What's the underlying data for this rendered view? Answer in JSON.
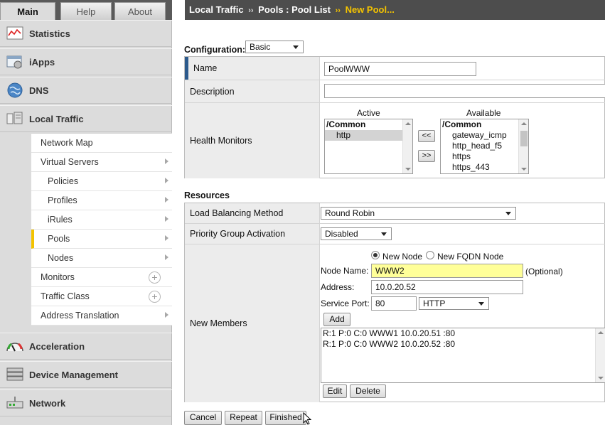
{
  "nav": {
    "tabs": [
      "Main",
      "Help",
      "About"
    ],
    "sections": {
      "statistics": "Statistics",
      "iapps": "iApps",
      "dns": "DNS",
      "local_traffic": "Local Traffic",
      "acceleration": "Acceleration",
      "device_management": "Device Management",
      "network": "Network"
    },
    "local_traffic_items": [
      {
        "label": "Network Map"
      },
      {
        "label": "Virtual Servers"
      },
      {
        "label": "Policies"
      },
      {
        "label": "Profiles"
      },
      {
        "label": "iRules"
      },
      {
        "label": "Pools"
      },
      {
        "label": "Nodes"
      },
      {
        "label": "Monitors"
      },
      {
        "label": "Traffic Class"
      },
      {
        "label": "Address Translation"
      }
    ],
    "active_item": "Pools"
  },
  "header": {
    "crumbs": [
      "Local Traffic",
      "Pools : Pool List",
      "New Pool..."
    ],
    "separator": "››"
  },
  "form": {
    "configuration_label": "Configuration:",
    "configuration_value": "Basic",
    "name_label": "Name",
    "name_value": "PoolWWW",
    "description_label": "Description",
    "description_value": "",
    "health_monitors_label": "Health Monitors",
    "active_label": "Active",
    "available_label": "Available",
    "active_list": [
      "/Common",
      "http"
    ],
    "available_list": [
      "/Common",
      "gateway_icmp",
      "http_head_f5",
      "https",
      "https_443"
    ],
    "move_left": "<<",
    "move_right": ">>"
  },
  "resources": {
    "title": "Resources",
    "lb_method_label": "Load Balancing Method",
    "lb_method_value": "Round Robin",
    "priority_label": "Priority Group Activation",
    "priority_value": "Disabled",
    "new_members_label": "New Members",
    "radio_new_node": "New Node",
    "radio_new_fqdn": "New FQDN Node",
    "node_name_label": "Node Name:",
    "node_name_value": "WWW2",
    "optional_label": "(Optional)",
    "address_label": "Address:",
    "address_value": "10.0.20.52",
    "service_port_label": "Service Port:",
    "service_port_value": "80",
    "service_value": "HTTP",
    "add_label": "Add",
    "members": [
      "R:1 P:0 C:0 WWW1 10.0.20.51 :80",
      "R:1 P:0 C:0 WWW2 10.0.20.52 :80"
    ],
    "edit_label": "Edit",
    "delete_label": "Delete"
  },
  "footer": {
    "cancel": "Cancel",
    "repeat": "Repeat",
    "finished": "Finished"
  },
  "colors": {
    "header_bg": "#4d4d4d",
    "crumb_current": "#f4c300",
    "node_name_highlight": "#ffff99",
    "active_marker": "#f3c300",
    "name_row_marker": "#2c5a8c"
  }
}
